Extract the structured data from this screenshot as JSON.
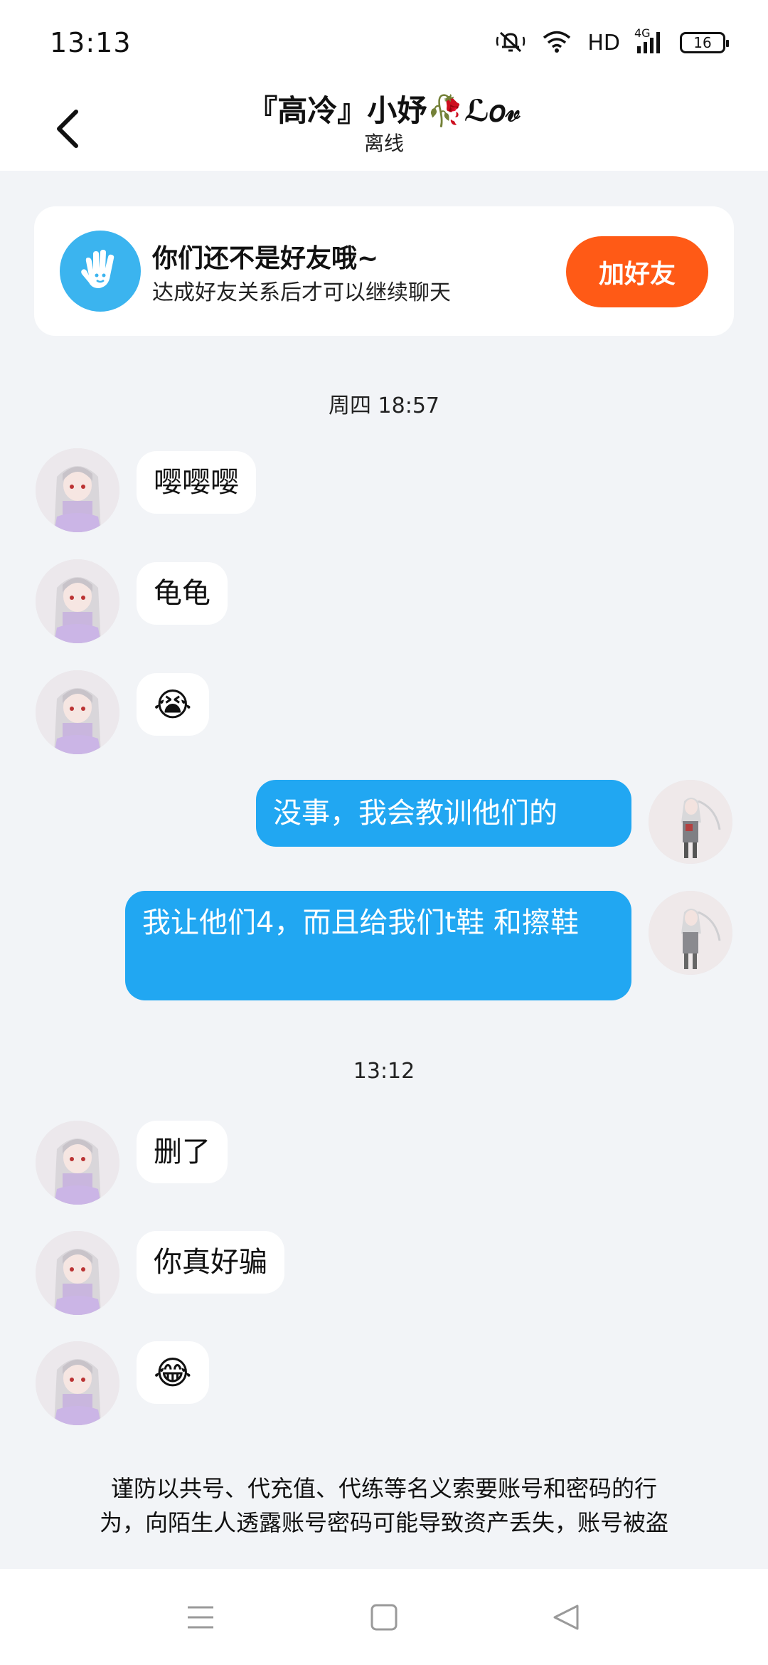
{
  "status_bar": {
    "time": "13:13",
    "network_hd": "HD",
    "network_4g": "4G",
    "battery": "16"
  },
  "header": {
    "contact_name": "『高冷』小妤🥀ℒ𝑜𝓋",
    "contact_status": "离线"
  },
  "friend_banner": {
    "title": "你们还不是好友哦~",
    "subtitle": "达成好友关系后才可以继续聊天",
    "add_button_label": "加好友"
  },
  "timestamps": {
    "first": "周四 18:57",
    "second": "13:12"
  },
  "messages": [
    {
      "side": "in",
      "text": "嘤嘤嘤"
    },
    {
      "side": "in",
      "text": "龟龟"
    },
    {
      "side": "in",
      "text": "😭"
    },
    {
      "side": "out",
      "text": "没事，我会教训他们的"
    },
    {
      "side": "out",
      "text": "我让他们4，而且给我们t鞋 和擦鞋"
    },
    {
      "side": "in",
      "text": "删了"
    },
    {
      "side": "in",
      "text": "你真好骗"
    },
    {
      "side": "in",
      "text": "😂"
    }
  ],
  "warning": {
    "line1": "谨防以共号、代充值、代练等名义索要账号和密码的行",
    "line2": "为，向陌生人透露账号密码可能导致资产丢失，账号被盗"
  },
  "icons": {
    "back": "chevron-left-icon",
    "hand": "hand-wave-icon",
    "menu": "menu-icon",
    "home": "home-square-icon",
    "back_nav": "back-triangle-icon"
  },
  "colors": {
    "accent_orange": "#ff5a16",
    "bubble_blue": "#21a7f2",
    "hand_blue": "#3bb4ef",
    "background": "#f2f4f7"
  }
}
